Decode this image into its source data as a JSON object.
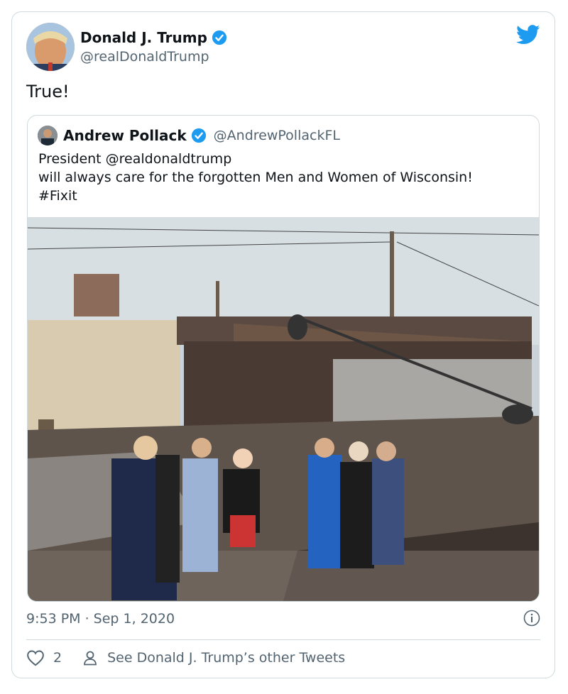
{
  "tweet": {
    "author_name": "Donald J. Trump",
    "author_handle": "@realDonaldTrump",
    "text": "True!",
    "timestamp": "9:53 PM · Sep 1, 2020",
    "like_count": "2",
    "other_tweets_label": "See Donald J. Trump’s other Tweets"
  },
  "quote": {
    "author_name": "Andrew Pollack",
    "author_handle": "@AndrewPollackFL",
    "lines": [
      "President @realdonaldtrump",
      "will always care for the forgotten Men and Women of Wisconsin!",
      "#Fixit"
    ]
  },
  "icons": {
    "logo": "twitter-bird-icon",
    "verified": "verified-badge-icon",
    "info": "info-icon",
    "like": "heart-icon",
    "profile": "person-icon"
  },
  "colors": {
    "twitter_blue": "#1d9bf0",
    "secondary_text": "#536471",
    "border": "#cfd9de"
  }
}
